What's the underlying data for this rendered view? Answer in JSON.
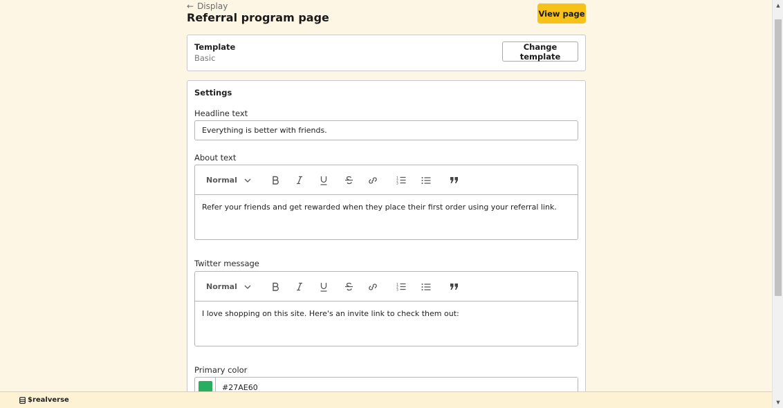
{
  "header": {
    "back_label": "Display",
    "title": "Referral program page",
    "view_page_label": "View page"
  },
  "template": {
    "label": "Template",
    "value": "Basic",
    "change_label": "Change template"
  },
  "settings": {
    "title": "Settings",
    "headline": {
      "label": "Headline text",
      "value": "Everything is better with friends."
    },
    "about": {
      "label": "About text",
      "format": "Normal",
      "value": "Refer your friends and get rewarded when they place their first order using your referral link."
    },
    "twitter": {
      "label": "Twitter message",
      "format": "Normal",
      "value": "I love shopping on this site. Here's an invite link to check them out:"
    },
    "primary_color": {
      "label": "Primary color",
      "value": "#27AE60",
      "swatch": "#27ae60"
    }
  },
  "toolbar_icons": [
    "bold-icon",
    "italic-icon",
    "underline-icon",
    "strikethrough-icon",
    "link-icon",
    "ordered-list-icon",
    "bullet-list-icon",
    "quote-icon"
  ],
  "footer": {
    "brand": "$realverse"
  },
  "colors": {
    "background": "#fef6e4",
    "accent": "#f6c21a"
  }
}
